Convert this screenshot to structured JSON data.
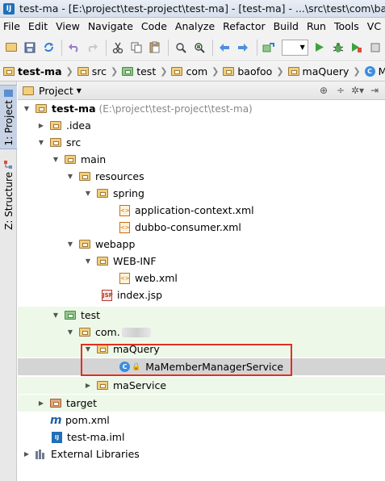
{
  "window": {
    "title": "test-ma - [E:\\project\\test-project\\test-ma] - [test-ma] - ...\\src\\test\\com\\baofoo",
    "app_icon": "IJ"
  },
  "menu": [
    "File",
    "Edit",
    "View",
    "Navigate",
    "Code",
    "Analyze",
    "Refactor",
    "Build",
    "Run",
    "Tools",
    "VC"
  ],
  "toolbar": {
    "icons": [
      "open-folder-icon",
      "save-icon",
      "sync-icon",
      "undo-icon",
      "redo-icon",
      "cut-icon",
      "copy-icon",
      "paste-icon",
      "find-icon",
      "replace-icon",
      "back-icon",
      "forward-icon",
      "make-icon",
      "run-config-combo",
      "run-icon",
      "debug-icon",
      "coverage-icon"
    ]
  },
  "breadcrumbs": [
    {
      "label": "test-ma",
      "kind": "project"
    },
    {
      "label": "src",
      "kind": "folder"
    },
    {
      "label": "test",
      "kind": "src-folder"
    },
    {
      "label": "com",
      "kind": "package"
    },
    {
      "label": "baofoo",
      "kind": "package"
    },
    {
      "label": "maQuery",
      "kind": "package"
    },
    {
      "label": "MaMer",
      "kind": "class"
    }
  ],
  "side_tabs": [
    {
      "label": "1: Project",
      "active": true
    },
    {
      "label": "Z: Structure",
      "active": false
    }
  ],
  "panel": {
    "title": "Project",
    "tools": [
      "target-icon",
      "collapse-icon",
      "settings-icon",
      "hide-icon"
    ]
  },
  "tree": [
    {
      "label": "test-ma",
      "hint": "(E:\\project\\test-project\\test-ma)",
      "depth": 0,
      "arrow": "open",
      "icon": "folder",
      "bold": true
    },
    {
      "label": ".idea",
      "depth": 1,
      "arrow": "closed",
      "icon": "folder"
    },
    {
      "label": "src",
      "depth": 1,
      "arrow": "open",
      "icon": "folder"
    },
    {
      "label": "main",
      "depth": 2,
      "arrow": "open",
      "icon": "folder"
    },
    {
      "label": "resources",
      "depth": 3,
      "arrow": "open",
      "icon": "folder"
    },
    {
      "label": "spring",
      "depth": 4,
      "arrow": "open",
      "icon": "package"
    },
    {
      "label": "application-context.xml",
      "depth": 5,
      "arrow": "none",
      "icon": "xml"
    },
    {
      "label": "dubbo-consumer.xml",
      "depth": 5,
      "arrow": "none",
      "icon": "xml"
    },
    {
      "label": "webapp",
      "depth": 2,
      "arrow": "open",
      "icon": "folder"
    },
    {
      "label": "WEB-INF",
      "depth": 3,
      "arrow": "open",
      "icon": "folder"
    },
    {
      "label": "web.xml",
      "depth": 4,
      "arrow": "none",
      "icon": "xml"
    },
    {
      "label": "index.jsp",
      "depth": 3,
      "arrow": "none",
      "icon": "jsp"
    },
    {
      "label": "test",
      "depth": 2,
      "arrow": "open",
      "icon": "src-folder",
      "test": true
    },
    {
      "label": "com.",
      "depth": 3,
      "arrow": "open",
      "icon": "package",
      "test": true,
      "blurred": true
    },
    {
      "label": "maQuery",
      "depth": 4,
      "arrow": "open",
      "icon": "package",
      "test": true
    },
    {
      "label": "MaMemberManagerService",
      "depth": 5,
      "arrow": "none",
      "icon": "class",
      "test": true,
      "selected": true
    },
    {
      "label": "maService",
      "depth": 4,
      "arrow": "closed",
      "icon": "package",
      "test": true
    },
    {
      "label": "target",
      "depth": 1,
      "arrow": "closed",
      "icon": "folder"
    },
    {
      "label": "pom.xml",
      "depth": 1,
      "arrow": "none",
      "icon": "pom"
    },
    {
      "label": "test-ma.iml",
      "depth": 1,
      "arrow": "none",
      "icon": "iml"
    },
    {
      "label": "External Libraries",
      "depth": 0,
      "arrow": "closed",
      "icon": "libraries"
    }
  ],
  "colors": {
    "selection": "#d4d4d4",
    "test_background": "#eef8e9",
    "highlight_border": "#e0301e",
    "folder": "#f1cf7c",
    "source_folder": "#8ec98a",
    "class_icon": "#3b8de0"
  }
}
